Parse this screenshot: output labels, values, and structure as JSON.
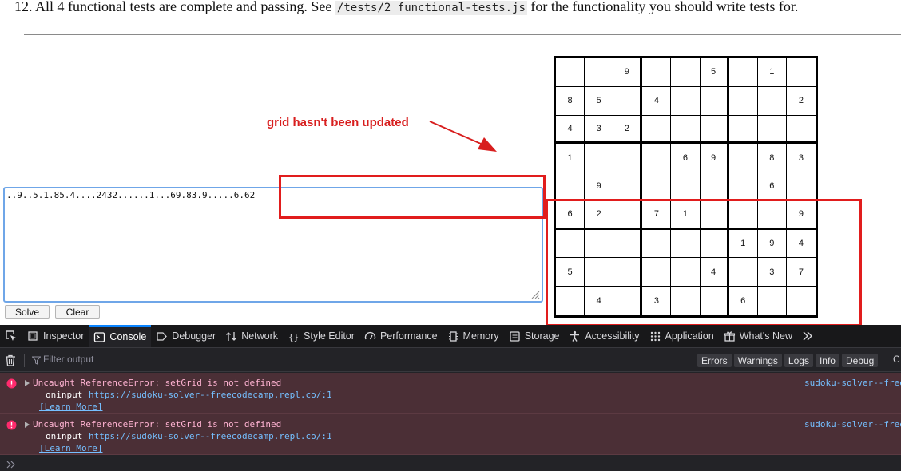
{
  "page": {
    "instruction_prefix": "12. All 4 functional tests are complete and passing. See ",
    "instruction_code": "/tests/2_functional-tests.js",
    "instruction_suffix": " for the functionality you should write tests for.",
    "annotation": "grid hasn't been updated",
    "puzzle_input": "..9..5.1.85.4....2432......1...69.83.9.....6.62",
    "buttons": {
      "solve": "Solve",
      "clear": "Clear"
    },
    "colors": {
      "annotation": "#d81e1e",
      "input_border": "#6fa6e8"
    }
  },
  "sudoku": {
    "rows": [
      [
        "",
        "",
        "9",
        "",
        "",
        "5",
        "",
        "1",
        ""
      ],
      [
        "8",
        "5",
        "",
        "4",
        "",
        "",
        "",
        "",
        "2"
      ],
      [
        "4",
        "3",
        "2",
        "",
        "",
        "",
        "",
        "",
        ""
      ],
      [
        "1",
        "",
        "",
        "",
        "6",
        "9",
        "",
        "8",
        "3"
      ],
      [
        "",
        "9",
        "",
        "",
        "",
        "",
        "",
        "6",
        ""
      ],
      [
        "6",
        "2",
        "",
        "7",
        "1",
        "",
        "",
        "",
        "9"
      ],
      [
        "",
        "",
        "",
        "",
        "",
        "",
        "1",
        "9",
        "4"
      ],
      [
        "5",
        "",
        "",
        "",
        "",
        "4",
        "",
        "3",
        "7"
      ],
      [
        "",
        "4",
        "",
        "3",
        "",
        "",
        "6",
        "",
        ""
      ]
    ]
  },
  "devtools": {
    "tabs": [
      {
        "label": "Inspector",
        "icon": "inspector-icon"
      },
      {
        "label": "Console",
        "icon": "console-icon",
        "active": true
      },
      {
        "label": "Debugger",
        "icon": "debugger-icon"
      },
      {
        "label": "Network",
        "icon": "network-icon"
      },
      {
        "label": "Style Editor",
        "icon": "style-editor-icon"
      },
      {
        "label": "Performance",
        "icon": "performance-icon"
      },
      {
        "label": "Memory",
        "icon": "memory-icon"
      },
      {
        "label": "Storage",
        "icon": "storage-icon"
      },
      {
        "label": "Accessibility",
        "icon": "accessibility-icon"
      },
      {
        "label": "Application",
        "icon": "application-icon"
      },
      {
        "label": "What's New",
        "icon": "whats-new-icon"
      }
    ],
    "filter_placeholder": "Filter output",
    "filter_buttons": [
      "Errors",
      "Warnings",
      "Logs",
      "Info",
      "Debug"
    ],
    "filter_truncated": "C",
    "messages": [
      {
        "title": "Uncaught ReferenceError: setGrid is not defined",
        "fn": "oninput",
        "url": "https://sudoku-solver--freecodecamp.repl.co/:1",
        "learn_more": "[Learn More]",
        "source": "sudoku-solver--freecodecamp.repl.co"
      },
      {
        "title": "Uncaught ReferenceError: setGrid is not defined",
        "fn": "oninput",
        "url": "https://sudoku-solver--freecodecamp.repl.co/:1",
        "learn_more": "[Learn More]",
        "source": "sudoku-solver--freecodecamp.repl.co"
      }
    ],
    "colors": {
      "active_tab": "#0a84ff",
      "error_bg": "#4b2f36",
      "error_text": "#ffb3d2",
      "link": "#75bfff"
    }
  }
}
